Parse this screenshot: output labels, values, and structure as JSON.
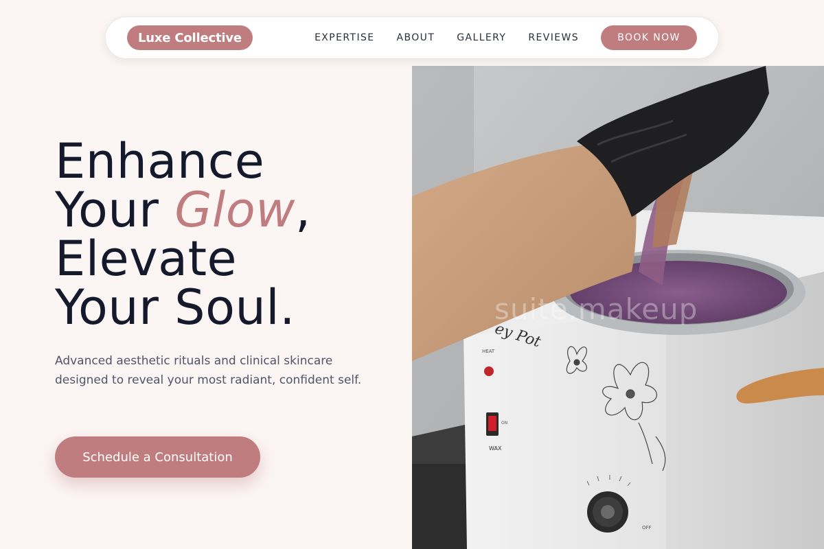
{
  "nav": {
    "brand": "Luxe Collective",
    "links": [
      "EXPERTISE",
      "ABOUT",
      "GALLERY",
      "REVIEWS"
    ],
    "cta": "BOOK NOW"
  },
  "hero": {
    "title_line1": "Enhance",
    "title_line2_pre": "Your ",
    "title_line2_accent": "Glow",
    "title_line2_post": ",",
    "title_line3": "Elevate",
    "title_line4": "Your Soul.",
    "subtitle": "Advanced aesthetic rituals and clinical skincare designed to reveal your most radiant, confident self.",
    "cta": "Schedule a Consultation"
  },
  "image": {
    "watermark": "suite.makeup",
    "warmer_on_label": "ON",
    "warmer_off_label": "OFF",
    "warmer_wax_label": "WAX",
    "warmer_heat_label": "HEAT"
  },
  "colors": {
    "accent": "#c07d7f",
    "background": "#fbf5f4",
    "heading": "#141a2b",
    "body_text": "#4f5567"
  }
}
